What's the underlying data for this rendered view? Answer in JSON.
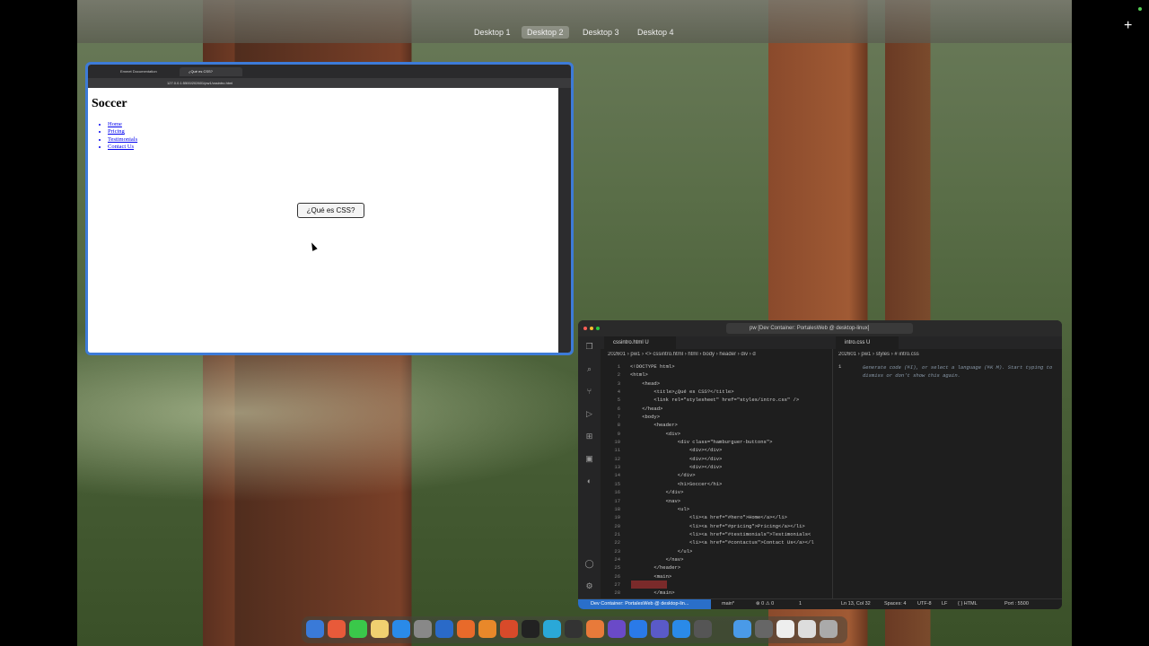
{
  "spaces": [
    "Desktop 1",
    "Desktop 2",
    "Desktop 3",
    "Desktop 4"
  ],
  "active_space": "Desktop 2",
  "browser": {
    "tabs": [
      "Emmet Documentation",
      "¿Qué es CSS?"
    ],
    "url": "127.0.0.1:5500/202601/pw1/cssintro.html",
    "page": {
      "title": "Soccer",
      "nav": [
        "Home",
        "Pricing",
        "Testimonials",
        "Contact Us"
      ],
      "button": "¿Qué es CSS?"
    }
  },
  "vscode": {
    "search": "pw [Dev Container: PortalesWeb @ desktop-linux]",
    "tab_left": "cssintro.html U",
    "tab_right": "intro.css U",
    "breadcrumb_left": "202601 › pw1 › <> cssintro.html › html › body › header › div › d",
    "breadcrumb_right": "202601 › pw1 › styles › # intro.css",
    "line_numbers": [
      "1",
      "2",
      "3",
      "4",
      "5",
      "6",
      "7",
      "8",
      "9",
      "10",
      "11",
      "12",
      "13",
      "14",
      "15",
      "16",
      "17",
      "18",
      "19",
      "20",
      "21",
      "22",
      "23",
      "24",
      "25",
      "26",
      "27",
      "28"
    ],
    "code": "<!DOCTYPE html>\n<html>\n    <head>\n        <title>¿Qué es CSS?</title>\n        <link rel=\"stylesheet\" href=\"styles/intro.css\" />\n    </head>\n    <body>\n        <header>\n            <div>\n                <div class=\"hamburguer-buttons\">\n                    <div></div>\n                    <div></div>\n                    <div></div>\n                </div>\n                <h1>Soccer</h1>\n            </div>\n            <nav>\n                <ul>\n                    <li><a href=\"#hero\">Home</a></li>\n                    <li><a href=\"#pricing\">Pricing</a></li>\n                    <li><a href=\"#testimonials\">Testimonials<\n                    <li><a href=\"#contactus\">Contact Us</a></l\n                </ul>\n            </nav>\n        </header>\n        <main>\n\n        </main>",
    "right_line": "1",
    "hint": "Generate code (⌘I), or select a language (⌘K M). Start typing to dismiss or don't show this again.",
    "status": {
      "remote": "Dev Container: PortalesWeb @ desktop-lin...",
      "branch": "main*",
      "problems": "⊗ 0 ⚠ 0",
      "ports": "1",
      "position": "Ln 13, Col 32",
      "spaces": "Spaces: 4",
      "encoding": "UTF-8",
      "eol": "LF",
      "language": "{ } HTML",
      "port": "Port : 5500"
    }
  }
}
